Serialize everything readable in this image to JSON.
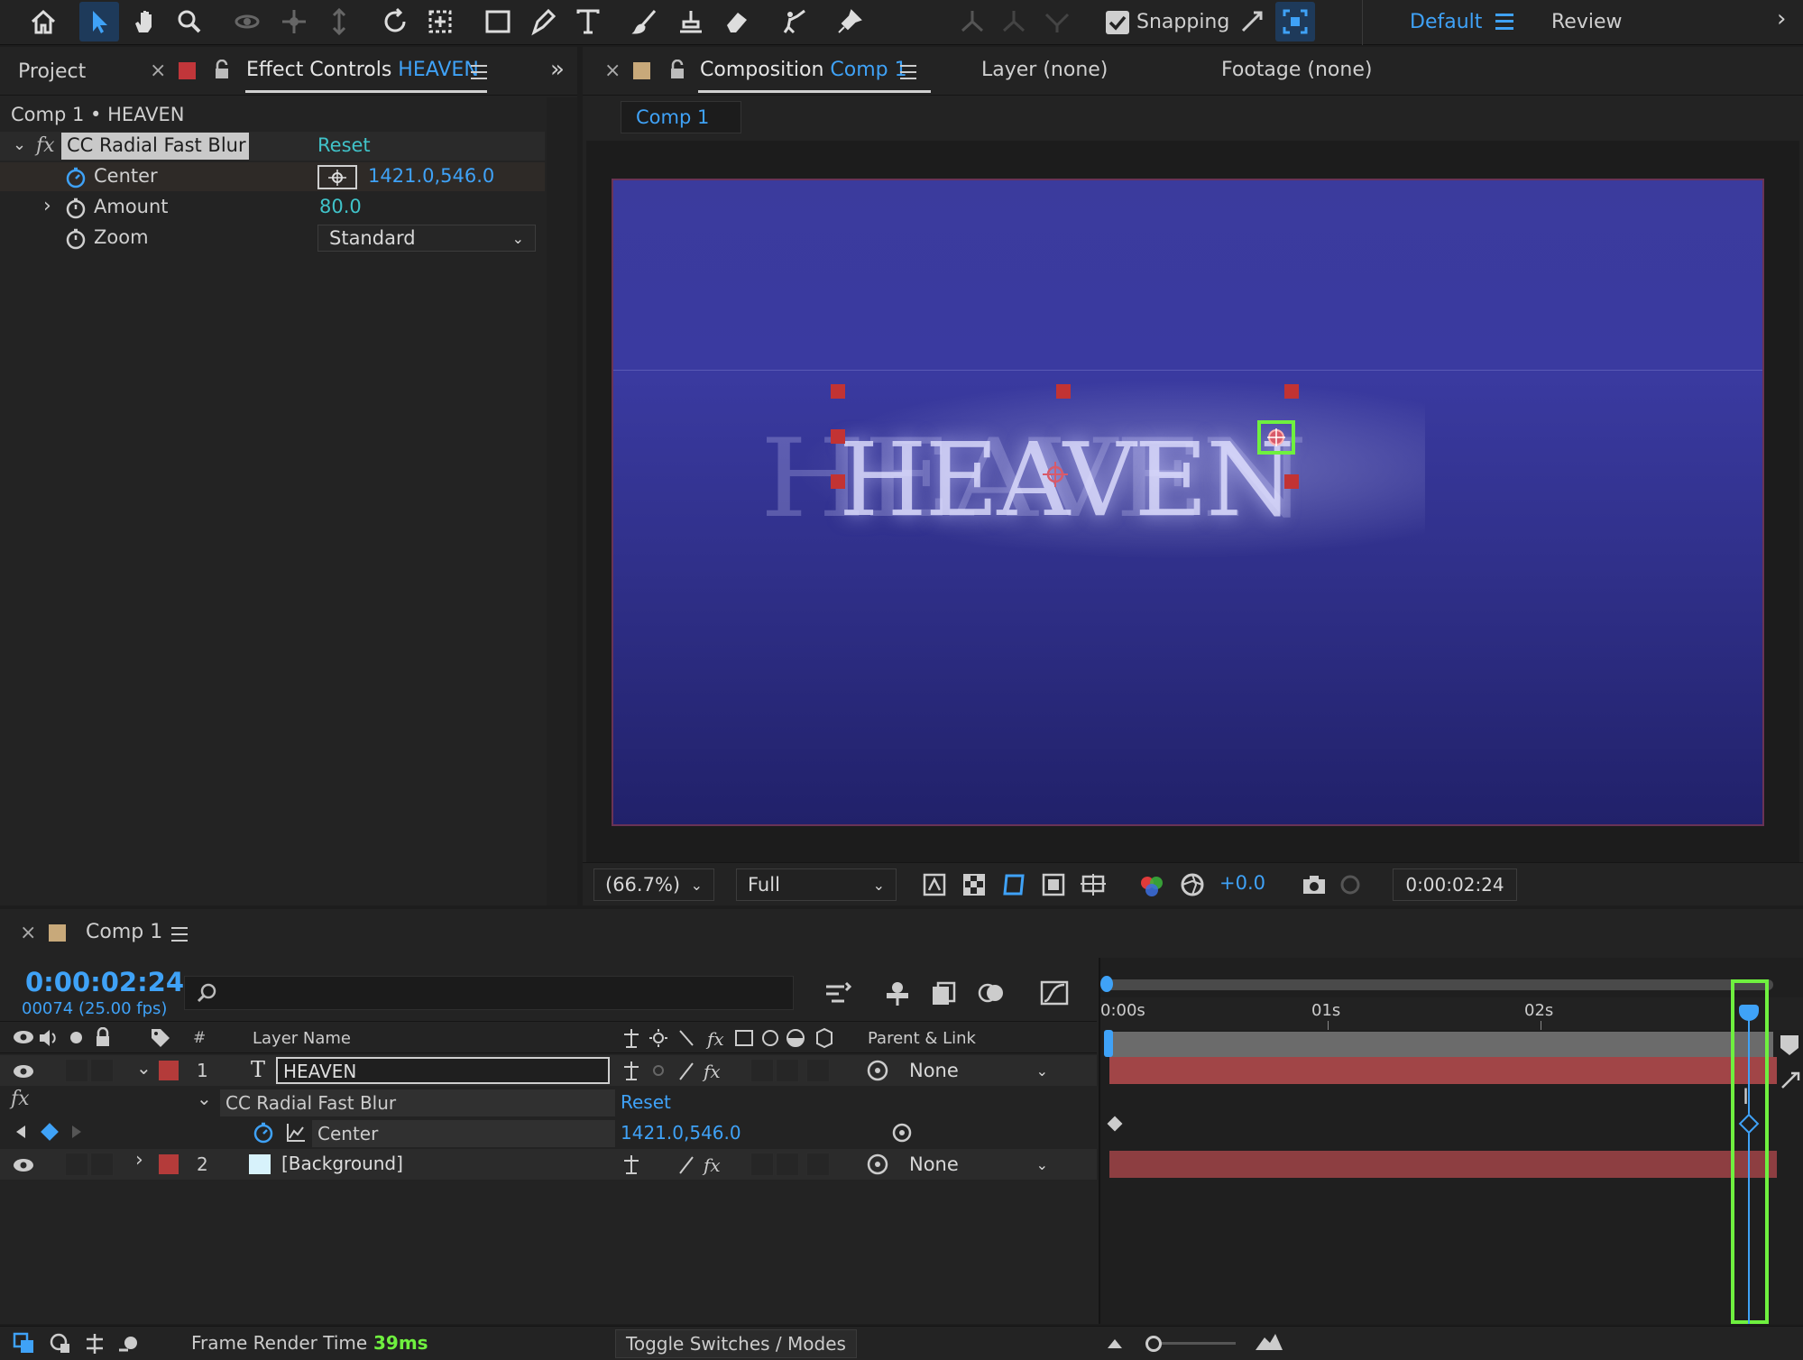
{
  "toolbar": {
    "snapping_label": "Snapping",
    "workspace_default": "Default",
    "workspace_review": "Review",
    "tools": [
      "home-icon",
      "selection-tool-icon",
      "hand-tool-icon",
      "zoom-tool-icon",
      "orbit-camera-icon",
      "pan-camera-icon",
      "dolly-camera-icon",
      "rotation-tool-icon",
      "pan-behind-tool-icon",
      "rectangle-tool-icon",
      "pen-tool-icon",
      "type-tool-icon",
      "brush-tool-icon",
      "clone-stamp-icon",
      "eraser-tool-icon",
      "roto-brush-icon",
      "puppet-pin-icon"
    ]
  },
  "left_panel": {
    "tab_project": "Project",
    "tab_effect_controls_prefix": "Effect Controls",
    "tab_effect_controls_layer": "HEAVEN",
    "breadcrumb": "Comp 1 • HEAVEN",
    "effect_name": "CC Radial Fast Blur",
    "reset_label": "Reset",
    "fx_symbol": "fx",
    "params": [
      {
        "name": "Center",
        "value": "1421.0,546.0"
      },
      {
        "name": "Amount",
        "value": "80.0"
      },
      {
        "name": "Zoom",
        "value": "Standard"
      }
    ]
  },
  "composition_panel": {
    "tab_prefix": "Composition",
    "tab_comp": "Comp 1",
    "tab_layer": "Layer (none)",
    "tab_footage": "Footage (none)",
    "sub_tab": "Comp 1",
    "canvas_text": "HEAVEN",
    "zoom_value": "(66.7%)",
    "resolution_value": "Full",
    "exposure_value": "+0.0",
    "timecode": "0:00:02:24"
  },
  "timeline": {
    "tab_title": "Comp 1",
    "current_time": "0:00:02:24",
    "frame_info": "00074 (25.00 fps)",
    "col_number": "#",
    "col_layer_name": "Layer Name",
    "col_parent": "Parent & Link",
    "ruler": [
      "0:00s",
      "01s",
      "02s"
    ],
    "layers": [
      {
        "index": "1",
        "type_glyph": "T",
        "name": "HEAVEN",
        "parent": "None",
        "label_color": "#b43b3a"
      },
      {
        "index": "2",
        "type_glyph": "",
        "name": "[Background]",
        "parent": "None",
        "label_color": "#b43b3a"
      }
    ],
    "effect_row": {
      "name": "CC Radial Fast Blur",
      "reset": "Reset"
    },
    "property_row": {
      "name": "Center",
      "value": "1421.0,546.0"
    }
  },
  "status_bar": {
    "render_label": "Frame Render Time",
    "render_value": "39ms",
    "toggle_label": "Toggle Switches / Modes"
  },
  "colors": {
    "accent_blue": "#3fa2f7",
    "highlight_green": "#6ff03f",
    "label_red": "#b43b3a",
    "comp_label_tan": "#c8a97a"
  }
}
